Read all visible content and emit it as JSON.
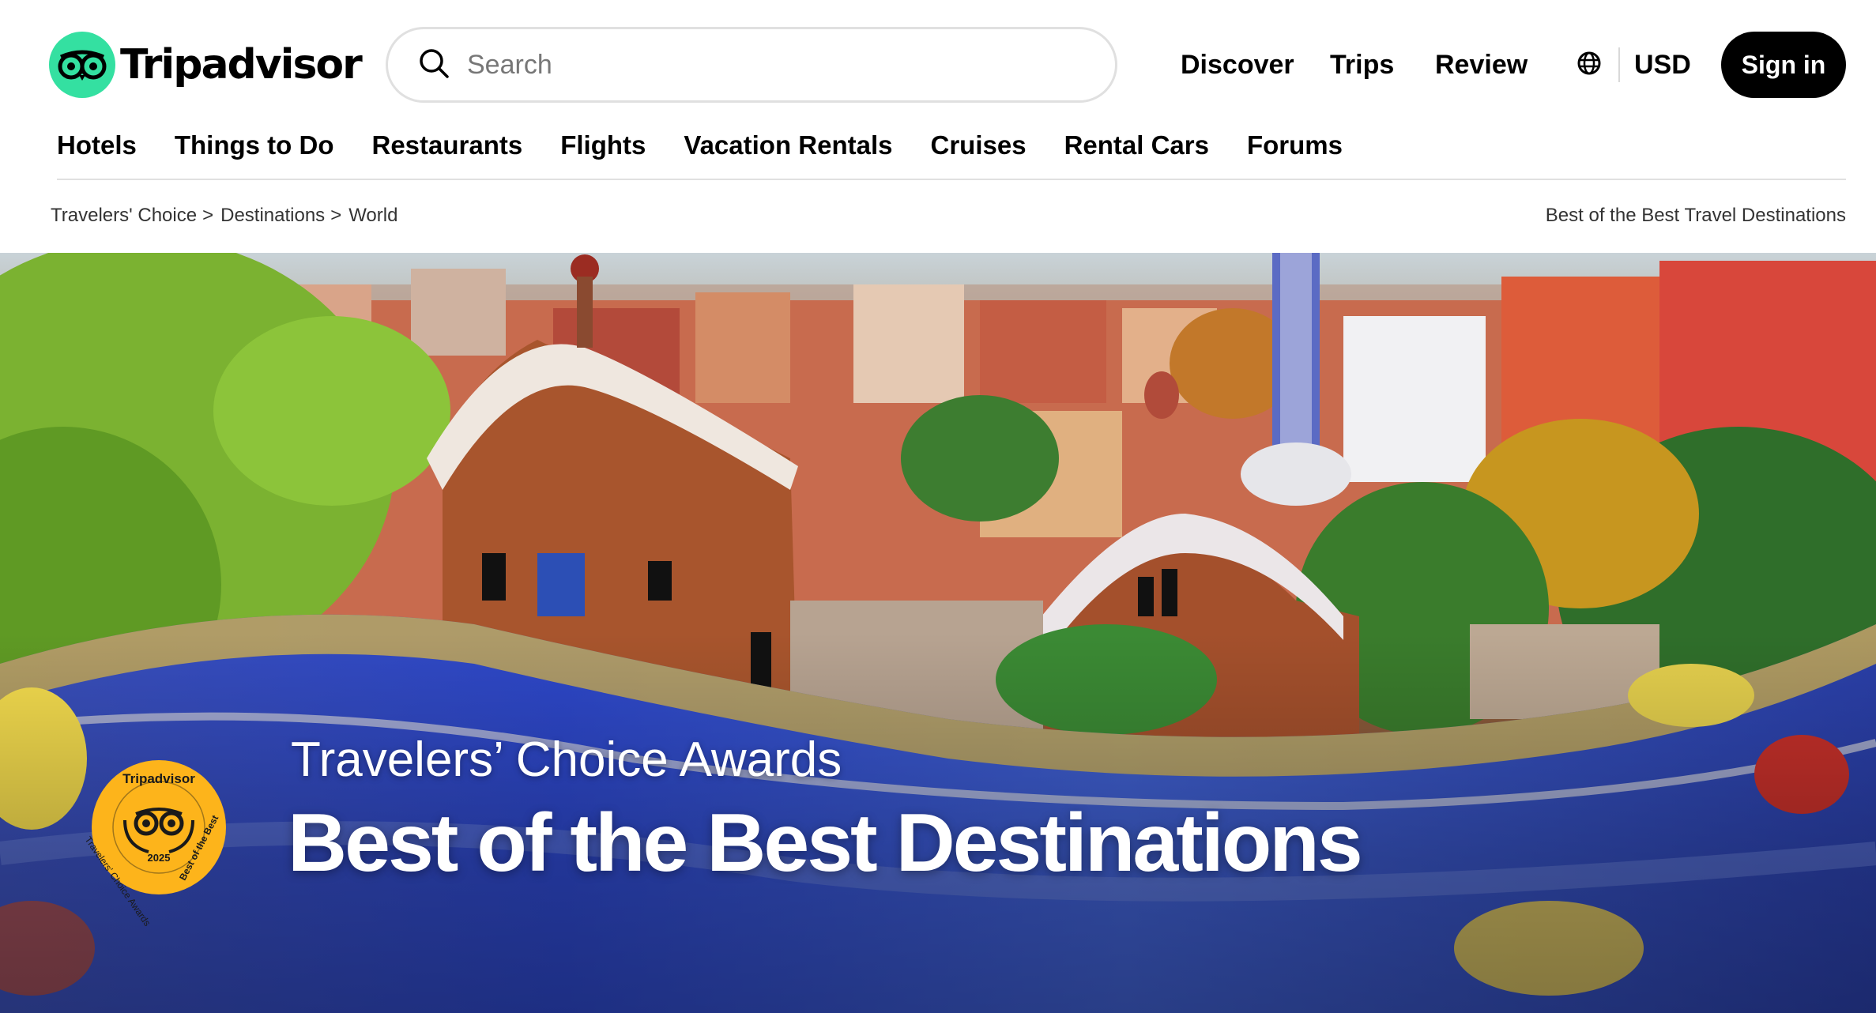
{
  "brand": {
    "name": "Tripadvisor",
    "accent": "#34e0a1"
  },
  "search": {
    "placeholder": "Search",
    "icon": "search-icon"
  },
  "top_nav": [
    {
      "label": "Discover"
    },
    {
      "label": "Trips"
    },
    {
      "label": "Review"
    }
  ],
  "locale": {
    "icon": "globe-icon",
    "currency": "USD"
  },
  "sign_in_label": "Sign in",
  "categories": [
    {
      "label": "Hotels"
    },
    {
      "label": "Things to Do"
    },
    {
      "label": "Restaurants"
    },
    {
      "label": "Flights"
    },
    {
      "label": "Vacation Rentals"
    },
    {
      "label": "Cruises"
    },
    {
      "label": "Rental Cars"
    },
    {
      "label": "Forums"
    }
  ],
  "breadcrumb": [
    {
      "label": "Travelers' Choice"
    },
    {
      "label": "Destinations"
    },
    {
      "label": "World"
    }
  ],
  "breadcrumb_separator": ">",
  "page_label": "Best of the Best Travel Destinations",
  "hero": {
    "subtitle": "Travelers’ Choice Awards",
    "title": "Best of the Best Destinations",
    "badge": {
      "brand": "Tripadvisor",
      "year": "2025",
      "left_text": "Travelers' Choice Awards",
      "right_text": "Best of the Best",
      "color": "#fdb41b"
    }
  }
}
